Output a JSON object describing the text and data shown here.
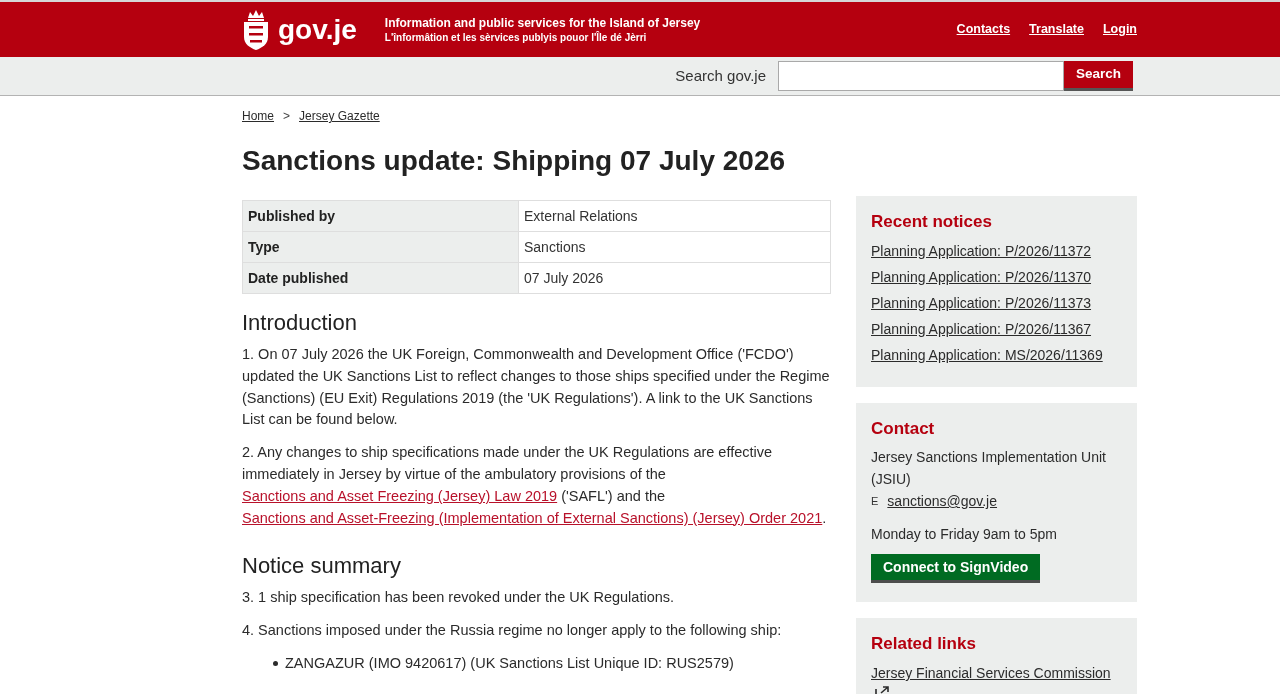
{
  "header": {
    "logo_text": "gov.je",
    "tagline": "Information and public services for the Island of Jersey",
    "tagline_jerriais": "L'înformâtion et les sèrvices publyis pouor l'Île dé Jèrri",
    "links": [
      "Contacts",
      "Translate",
      "Login"
    ]
  },
  "search": {
    "label": "Search gov.je",
    "button": "Search"
  },
  "breadcrumb": {
    "items": [
      "Home",
      "Jersey Gazette"
    ],
    "separator": ">"
  },
  "title": "Sanctions update: Shipping 07 July 2026",
  "details": [
    {
      "label": "Published by",
      "value": "External Relations"
    },
    {
      "label": "Type",
      "value": "Sanctions"
    },
    {
      "label": "Date published",
      "value": "07 July 2026"
    }
  ],
  "sections": [
    {
      "heading": "Introduction",
      "blocks": [
        {
          "kind": "paragraph",
          "parts": [
            {
              "kind": "text",
              "text": "1. On 07 July 2026 the UK Foreign, Commonwealth and Development Office ('FCDO') updated the UK Sanctions List to reflect changes to those ships specified under the Regime (Sanctions) (EU Exit) Regulations 2019 (the 'UK Regulations'). A link to the UK Sanctions List can be found below."
            }
          ]
        },
        {
          "kind": "paragraph",
          "parts": [
            {
              "kind": "text",
              "text": "2. Any changes to ship specifications made under the UK Regulations are effective immediately in Jersey by virtue of the ambulatory provisions of the "
            },
            {
              "kind": "link",
              "text": "Sanctions and Asset Freezing (Jersey) Law 2019"
            },
            {
              "kind": "text",
              "text": " ('SAFL') and the "
            },
            {
              "kind": "link",
              "text": "Sanctions and Asset-Freezing (Implementation of External Sanctions) (Jersey) Order 2021"
            },
            {
              "kind": "text",
              "text": "."
            }
          ]
        }
      ]
    },
    {
      "heading": "Notice summary",
      "blocks": [
        {
          "kind": "paragraph",
          "parts": [
            {
              "kind": "text",
              "text": "3. 1 ship specification has been revoked under the UK Regulations."
            }
          ]
        },
        {
          "kind": "paragraph",
          "parts": [
            {
              "kind": "text",
              "text": "4. Sanctions imposed under the Russia regime no longer apply to the following ship:"
            }
          ]
        },
        {
          "kind": "bullets",
          "items": [
            "ZANGAZUR (IMO 9420617) (UK Sanctions List Unique ID: RUS2579)"
          ]
        }
      ]
    }
  ],
  "sidebar": {
    "recent_notices": {
      "heading": "Recent notices",
      "links": [
        "Planning Application: P/2026/11372",
        "Planning Application: P/2026/11370",
        "Planning Application: P/2026/11373",
        "Planning Application: P/2026/11367",
        "Planning Application: MS/2026/11369"
      ]
    },
    "contact": {
      "heading": "Contact",
      "organisation": "Jersey Sanctions Implementation Unit (JSIU)",
      "email_label": "E",
      "email": "sanctions@gov.je",
      "hours": "Monday to Friday 9am to 5pm",
      "button": "Connect to SignVideo"
    },
    "related_links": {
      "heading": "Related links",
      "links": [
        {
          "text": "Jersey Financial Services Commission",
          "external": true
        }
      ]
    }
  }
}
